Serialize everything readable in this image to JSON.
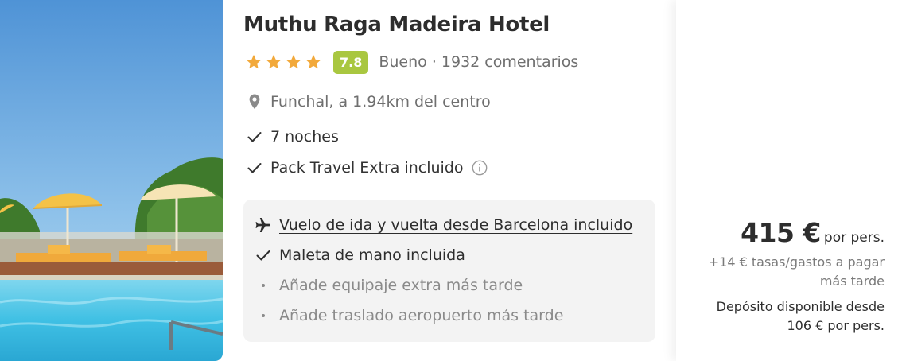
{
  "hotel": {
    "name": "Muthu Raga Madeira Hotel",
    "stars": 4,
    "score": "7.8",
    "score_color": "#a9c740",
    "rating_text": "Bueno · 1932 comentarios",
    "location": "Funchal, a 1.94km del centro",
    "location_icon": "map-pin-icon"
  },
  "features": [
    {
      "text": "7 noches",
      "icon": "checkmark-icon"
    },
    {
      "text": "Pack Travel Extra incluido",
      "icon": "checkmark-icon",
      "extra_icon": "info-icon"
    }
  ],
  "flight": {
    "items": [
      {
        "text": "Vuelo de ida y vuelta desde Barcelona incluido",
        "icon": "airplane-icon"
      },
      {
        "text": "Maleta de mano incluida",
        "icon": "checkmark-icon"
      },
      {
        "text": "Añade equipaje extra más tarde",
        "icon": "bullet-dot"
      },
      {
        "text": "Añade traslado aeropuerto más tarde",
        "icon": "bullet-dot"
      }
    ]
  },
  "price": {
    "amount": "415 €",
    "per": "por pers.",
    "fees": "+14 € tasas/gastos a pagar más tarde",
    "deposit": "Depósito disponible desde 106 € por pers."
  },
  "colors": {
    "star": "#f2a93b",
    "text": "#333333",
    "muted": "#6f6f6f",
    "panel": "#f3f3f3"
  }
}
